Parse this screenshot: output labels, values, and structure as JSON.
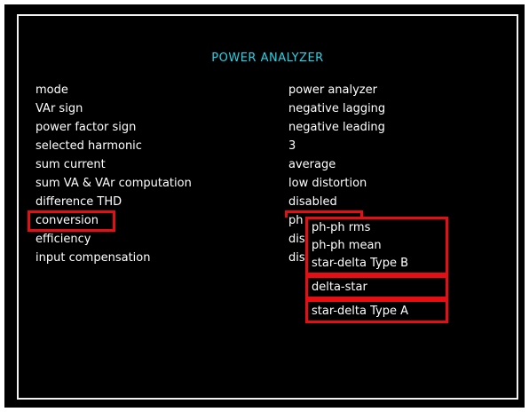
{
  "screen": {
    "title": "POWER ANALYZER"
  },
  "settings": [
    {
      "label": "mode",
      "value": "power analyzer"
    },
    {
      "label": "VAr sign",
      "value": "negative lagging"
    },
    {
      "label": "power factor sign",
      "value": "negative leading"
    },
    {
      "label": "selected harmonic",
      "value": "3"
    },
    {
      "label": "sum current",
      "value": "average"
    },
    {
      "label": "sum VA & VAr computation",
      "value": "low distortion"
    },
    {
      "label": "difference THD",
      "value": "disabled"
    },
    {
      "label": "conversion",
      "value": "ph"
    },
    {
      "label": "efficiency",
      "value": "dis"
    },
    {
      "label": "input compensation",
      "value": "dis"
    }
  ],
  "conversion_dropdown": {
    "options": [
      "ph-ph rms",
      "ph-ph mean",
      "star-delta Type B",
      "delta-star",
      "star-delta Type A"
    ]
  },
  "colors": {
    "background": "#000000",
    "frame": "#f2f2f2",
    "title": "#22d4e8",
    "text": "#ffffff",
    "highlight": "#e60d13"
  }
}
